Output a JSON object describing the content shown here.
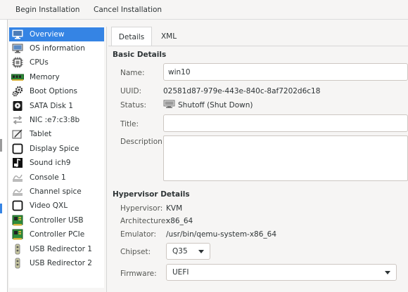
{
  "toolbar": {
    "begin_label": "Begin Installation",
    "cancel_label": "Cancel Installation"
  },
  "sidebar": {
    "items": [
      {
        "label": "Overview",
        "icon": "monitor-icon",
        "selected": true
      },
      {
        "label": "OS information",
        "icon": "monitor-info-icon"
      },
      {
        "label": "CPUs",
        "icon": "cpu-icon"
      },
      {
        "label": "Memory",
        "icon": "memory-icon"
      },
      {
        "label": "Boot Options",
        "icon": "gears-icon"
      },
      {
        "label": "SATA Disk 1",
        "icon": "disk-icon"
      },
      {
        "label": "NIC :e7:c3:8b",
        "icon": "nic-icon"
      },
      {
        "label": "Tablet",
        "icon": "tablet-icon"
      },
      {
        "label": "Display Spice",
        "icon": "display-icon"
      },
      {
        "label": "Sound ich9",
        "icon": "sound-icon"
      },
      {
        "label": "Console 1",
        "icon": "console-icon"
      },
      {
        "label": "Channel spice",
        "icon": "channel-icon"
      },
      {
        "label": "Video QXL",
        "icon": "video-icon"
      },
      {
        "label": "Controller USB",
        "icon": "controller-icon"
      },
      {
        "label": "Controller PCIe",
        "icon": "controller-icon"
      },
      {
        "label": "USB Redirector 1",
        "icon": "usb-redirector-icon"
      },
      {
        "label": "USB Redirector 2",
        "icon": "usb-redirector-icon"
      }
    ]
  },
  "tabs": {
    "details": "Details",
    "xml": "XML"
  },
  "basic": {
    "title": "Basic Details",
    "name_label": "Name:",
    "name_value": "win10",
    "uuid_label": "UUID:",
    "uuid_value": "02581d87-979e-443e-840c-8af7202d6c18",
    "status_label": "Status:",
    "status_value": "Shutoff (Shut Down)",
    "title_label": "Title:",
    "title_value": "",
    "description_label": "Description:"
  },
  "hypervisor": {
    "title": "Hypervisor Details",
    "hypervisor_label": "Hypervisor:",
    "hypervisor_value": "KVM",
    "arch_label": "Architecture:",
    "arch_value": "x86_64",
    "emulator_label": "Emulator:",
    "emulator_value": "/usr/bin/qemu-system-x86_64",
    "chipset_label": "Chipset:",
    "chipset_value": "Q35",
    "firmware_label": "Firmware:",
    "firmware_value": "UEFI"
  },
  "colors": {
    "selection": "#3584e4",
    "window_bg": "#f6f5f4"
  }
}
